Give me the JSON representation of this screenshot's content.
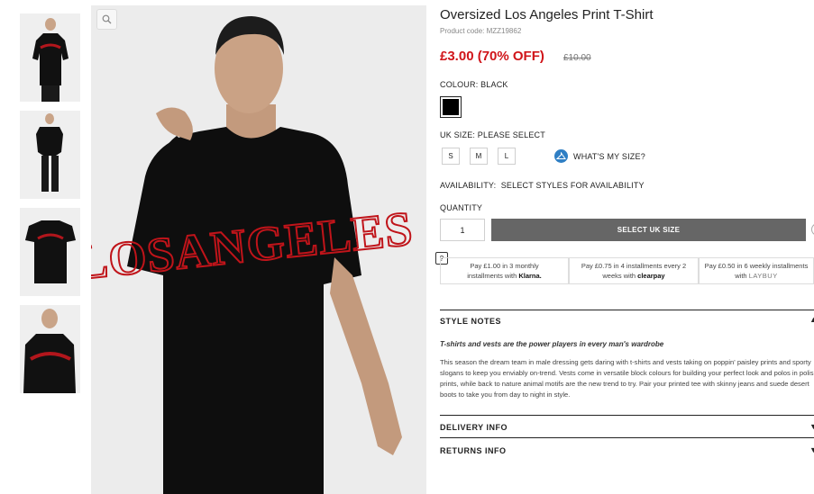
{
  "product": {
    "title": "Oversized Los Angeles Print T-Shirt",
    "code": "Product code: MZZ19862",
    "price": "£3.00 (70% OFF)",
    "old_price": "£10.00"
  },
  "colour": {
    "label": "COLOUR:",
    "value": " BLACK",
    "swatch_color": "#000000"
  },
  "size": {
    "label": "UK SIZE:",
    "value": " PLEASE SELECT",
    "options": [
      "S",
      "M",
      "L"
    ],
    "size_help": "WHAT'S MY SIZE?"
  },
  "availability": {
    "label": "AVAILABILITY:",
    "value": "SELECT STYLES FOR AVAILABILITY"
  },
  "quantity": {
    "label": "QUANTITY",
    "value": "1"
  },
  "add_button": "SELECT UK SIZE",
  "help_mark": "?",
  "payments": [
    {
      "line1": "Pay £1.00 in 3 monthly",
      "line2": "installments with ",
      "brand": "Klarna."
    },
    {
      "line1": "Pay £0.75 in 4 installments every 2",
      "line2": "weeks with ",
      "brand": "clearpay"
    },
    {
      "line1": "Pay £0.50 in 6 weekly installments",
      "line2": "with ",
      "brand": "LAYBUY"
    }
  ],
  "style_notes": {
    "heading": "STYLE NOTES",
    "tagline": "T-shirts and vests are the power players in every man's wardrobe",
    "body": "This season the dream team in male dressing gets daring with t-shirts and vests taking on poppin' paisley prints and sporty slogans to keep you enviably on-trend. Vests come in versatile block colours for building your perfect look and polos in polished prints, while back to nature animal motifs are the new trend to try. Pair your printed tee with skinny jeans and suede desert boots to take you from day to night in style."
  },
  "delivery": "DELIVERY INFO",
  "returns": "RETURNS INFO",
  "print_text": "LOSANGELES",
  "colors": {
    "sale": "#d01419",
    "print": "#c0141a",
    "button": "#666666"
  }
}
